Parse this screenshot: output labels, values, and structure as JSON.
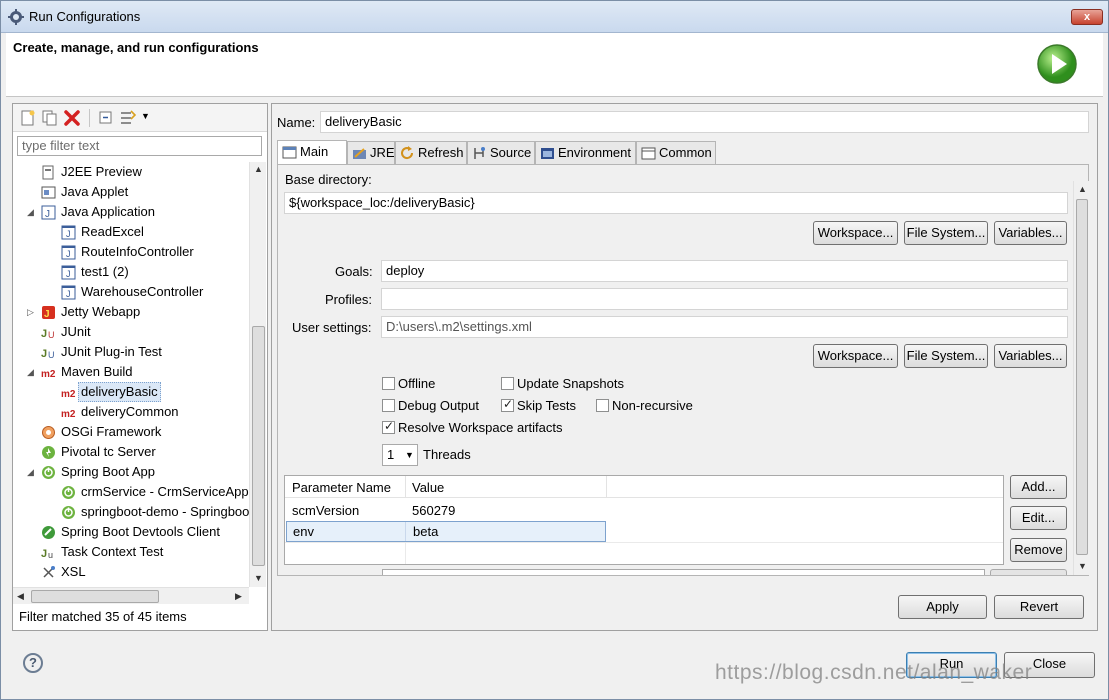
{
  "window": {
    "title": "Run Configurations",
    "close": "x"
  },
  "header": {
    "text": "Create, manage, and run configurations"
  },
  "left": {
    "filter_placeholder": "type filter text",
    "tree": [
      {
        "label": "J2EE Preview",
        "level": 0,
        "icon": "j2ee-icon",
        "expander": ""
      },
      {
        "label": "Java Applet",
        "level": 0,
        "icon": "applet-icon",
        "expander": ""
      },
      {
        "label": "Java Application",
        "level": 0,
        "icon": "java-app-icon",
        "expander": "◢"
      },
      {
        "label": "ReadExcel",
        "level": 1,
        "icon": "java-class-icon",
        "expander": ""
      },
      {
        "label": "RouteInfoController",
        "level": 1,
        "icon": "java-class-icon",
        "expander": ""
      },
      {
        "label": "test1 (2)",
        "level": 1,
        "icon": "java-class-icon",
        "expander": ""
      },
      {
        "label": "WarehouseController",
        "level": 1,
        "icon": "java-class-icon",
        "expander": ""
      },
      {
        "label": "Jetty Webapp",
        "level": 0,
        "icon": "jetty-icon",
        "expander": "▷"
      },
      {
        "label": "JUnit",
        "level": 0,
        "icon": "junit-icon",
        "expander": ""
      },
      {
        "label": "JUnit Plug-in Test",
        "level": 0,
        "icon": "junit-plugin-icon",
        "expander": ""
      },
      {
        "label": "Maven Build",
        "level": 0,
        "icon": "maven-icon",
        "expander": "◢"
      },
      {
        "label": "deliveryBasic",
        "level": 1,
        "icon": "maven-icon",
        "expander": "",
        "selected": true
      },
      {
        "label": "deliveryCommon",
        "level": 1,
        "icon": "maven-icon",
        "expander": ""
      },
      {
        "label": "OSGi Framework",
        "level": 0,
        "icon": "osgi-icon",
        "expander": ""
      },
      {
        "label": "Pivotal tc Server",
        "level": 0,
        "icon": "pivotal-icon",
        "expander": ""
      },
      {
        "label": "Spring Boot App",
        "level": 0,
        "icon": "spring-boot-icon",
        "expander": "◢"
      },
      {
        "label": "crmService - CrmServiceApplication",
        "level": 1,
        "icon": "spring-boot-icon",
        "expander": ""
      },
      {
        "label": "springboot-demo - SpringbootDemoApplication",
        "level": 1,
        "icon": "spring-boot-icon",
        "expander": ""
      },
      {
        "label": "Spring Boot Devtools Client",
        "level": 0,
        "icon": "devtools-icon",
        "expander": ""
      },
      {
        "label": "Task Context Test",
        "level": 0,
        "icon": "task-icon",
        "expander": ""
      },
      {
        "label": "XSL",
        "level": 0,
        "icon": "xsl-icon",
        "expander": ""
      }
    ],
    "filter_status": "Filter matched 35 of 45 items"
  },
  "right": {
    "name_label": "Name:",
    "name_value": "deliveryBasic",
    "tabs": [
      {
        "label": "Main",
        "icon": "main-tab-icon"
      },
      {
        "label": "JRE",
        "icon": "jre-icon"
      },
      {
        "label": "Refresh",
        "icon": "refresh-icon"
      },
      {
        "label": "Source",
        "icon": "source-icon"
      },
      {
        "label": "Environment",
        "icon": "environment-icon"
      },
      {
        "label": "Common",
        "icon": "common-icon"
      }
    ],
    "base_dir_label": "Base directory:",
    "base_dir_value": "${workspace_loc:/deliveryBasic}",
    "workspace_btn": "Workspace...",
    "filesystem_btn": "File System...",
    "variables_btn": "Variables...",
    "goals_label": "Goals:",
    "goals_value": "deploy",
    "profiles_label": "Profiles:",
    "profiles_value": "",
    "user_settings_label": "User settings:",
    "user_settings_value": "D:\\users\\.m2\\settings.xml",
    "checks": {
      "offline": "Offline",
      "update_snapshots": "Update Snapshots",
      "debug_output": "Debug Output",
      "skip_tests": "Skip Tests",
      "non_recursive": "Non-recursive",
      "resolve_workspace": "Resolve Workspace artifacts"
    },
    "threads_value": "1",
    "threads_label": "Threads",
    "params": {
      "headers": [
        "Parameter Name",
        "Value"
      ],
      "rows": [
        [
          "scmVersion",
          "560279"
        ],
        [
          "env",
          "beta"
        ]
      ]
    },
    "add_btn": "Add...",
    "edit_btn": "Edit...",
    "remove_btn": "Remove",
    "apply_btn": "Apply",
    "revert_btn": "Revert"
  },
  "footer": {
    "run_btn": "Run",
    "close_btn": "Close",
    "help": "?"
  },
  "watermark": "https://blog.csdn.net/alan_waker"
}
